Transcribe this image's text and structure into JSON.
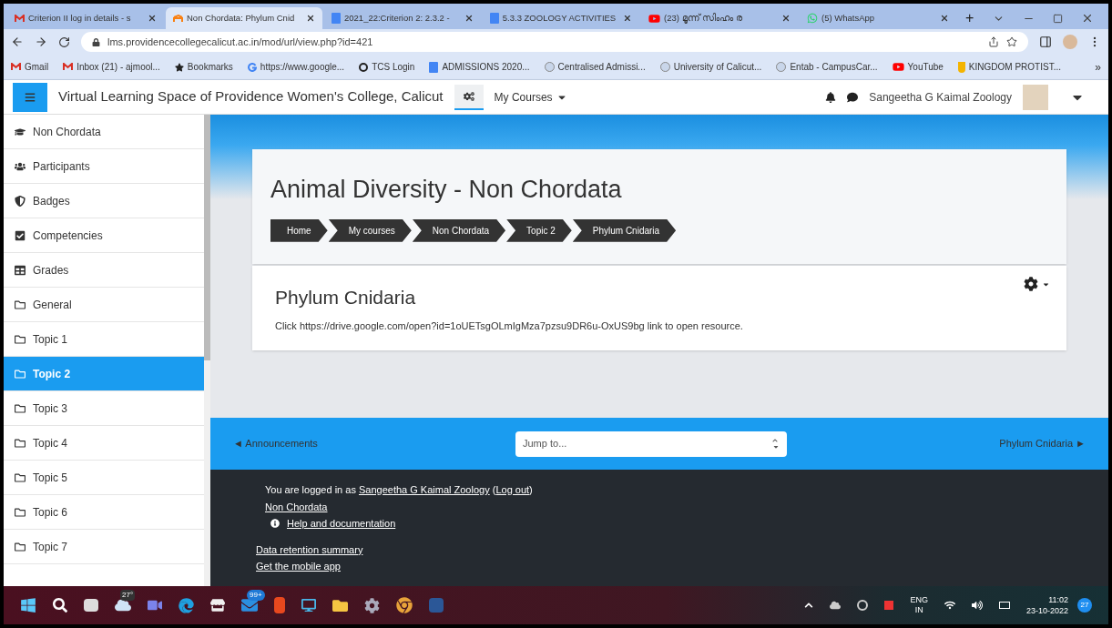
{
  "browser": {
    "tabs": [
      {
        "title": "Criterion II log in details - s",
        "selected": false,
        "kind": "gmail"
      },
      {
        "title": "Non Chordata: Phylum Cnid",
        "selected": true,
        "kind": "moodle"
      },
      {
        "title": "2021_22:Criterion 2: 2.3.2 -",
        "selected": false,
        "kind": "docs"
      },
      {
        "title": "5.3.3 ZOOLOGY ACTIVITIES",
        "selected": false,
        "kind": "docs"
      },
      {
        "title": "(23) മൂന്ന് സിംഹം ര",
        "selected": false,
        "kind": "youtube"
      },
      {
        "title": "(5) WhatsApp",
        "selected": false,
        "kind": "whatsapp"
      }
    ],
    "new_tab": "+",
    "url": "lms.providencecollegecalicut.ac.in/mod/url/view.php?id=421",
    "bookmarks": [
      {
        "label": "Gmail",
        "kind": "gmail"
      },
      {
        "label": "Inbox (21) - ajmool...",
        "kind": "gmail"
      },
      {
        "label": "Bookmarks",
        "kind": "star"
      },
      {
        "label": "https://www.google...",
        "kind": "google"
      },
      {
        "label": "TCS Login",
        "kind": "tcs"
      },
      {
        "label": "ADMISSIONS 2020...",
        "kind": "docs"
      },
      {
        "label": "Centralised Admissi...",
        "kind": "logo"
      },
      {
        "label": "University of Calicut...",
        "kind": "logo"
      },
      {
        "label": "Entab - CampusCar...",
        "kind": "logo"
      },
      {
        "label": "YouTube",
        "kind": "youtube"
      },
      {
        "label": "KINGDOM PROTIST...",
        "kind": "medal"
      }
    ],
    "more": "»"
  },
  "header": {
    "site_title": "Virtual Learning Space of Providence Women's College, Calicut",
    "menu": "My Courses",
    "user": "Sangeetha G Kaimal Zoology"
  },
  "sidebar": {
    "items": [
      {
        "label": "Non Chordata",
        "kind": "course",
        "selected": false
      },
      {
        "label": "Participants",
        "kind": "participants",
        "selected": false
      },
      {
        "label": "Badges",
        "kind": "badges",
        "selected": false
      },
      {
        "label": "Competencies",
        "kind": "competencies",
        "selected": false
      },
      {
        "label": "Grades",
        "kind": "grades",
        "selected": false
      },
      {
        "label": "General",
        "kind": "section",
        "selected": false
      },
      {
        "label": "Topic 1",
        "kind": "section",
        "selected": false
      },
      {
        "label": "Topic 2",
        "kind": "section",
        "selected": true
      },
      {
        "label": "Topic 3",
        "kind": "section",
        "selected": false
      },
      {
        "label": "Topic 4",
        "kind": "section",
        "selected": false
      },
      {
        "label": "Topic 5",
        "kind": "section",
        "selected": false
      },
      {
        "label": "Topic 6",
        "kind": "section",
        "selected": false
      },
      {
        "label": "Topic 7",
        "kind": "section",
        "selected": false
      }
    ]
  },
  "course": {
    "title": "Animal Diversity - Non Chordata",
    "breadcrumbs": [
      "Home",
      "My courses",
      "Non Chordata",
      "Topic 2",
      "Phylum Cnidaria"
    ]
  },
  "resource": {
    "title": "Phylum Cnidaria",
    "text": "Click https://drive.google.com/open?id=1oUETsgOLmIgMza7pzsu9DR6u-OxUS9bg link to open resource."
  },
  "activity_nav": {
    "previous": "◄ Announcements",
    "jump": "Jump to...",
    "next": "Phylum Cnidaria ►"
  },
  "footer": {
    "logged_in_prefix": "You are logged in as",
    "user_link": "Sangeetha G Kaimal Zoology",
    "logout_open": "(",
    "logout": "Log out",
    "logout_close": ")",
    "course_link": "Non Chordata",
    "help": "Help and documentation",
    "data_retention": "Data retention summary",
    "mobile_app": "Get the mobile app"
  },
  "taskbar": {
    "weather": "27°",
    "mail_badge": "99+",
    "language": "ENG",
    "region": "IN",
    "time": "11:02",
    "date": "23-10-2022",
    "notifications": "27"
  }
}
